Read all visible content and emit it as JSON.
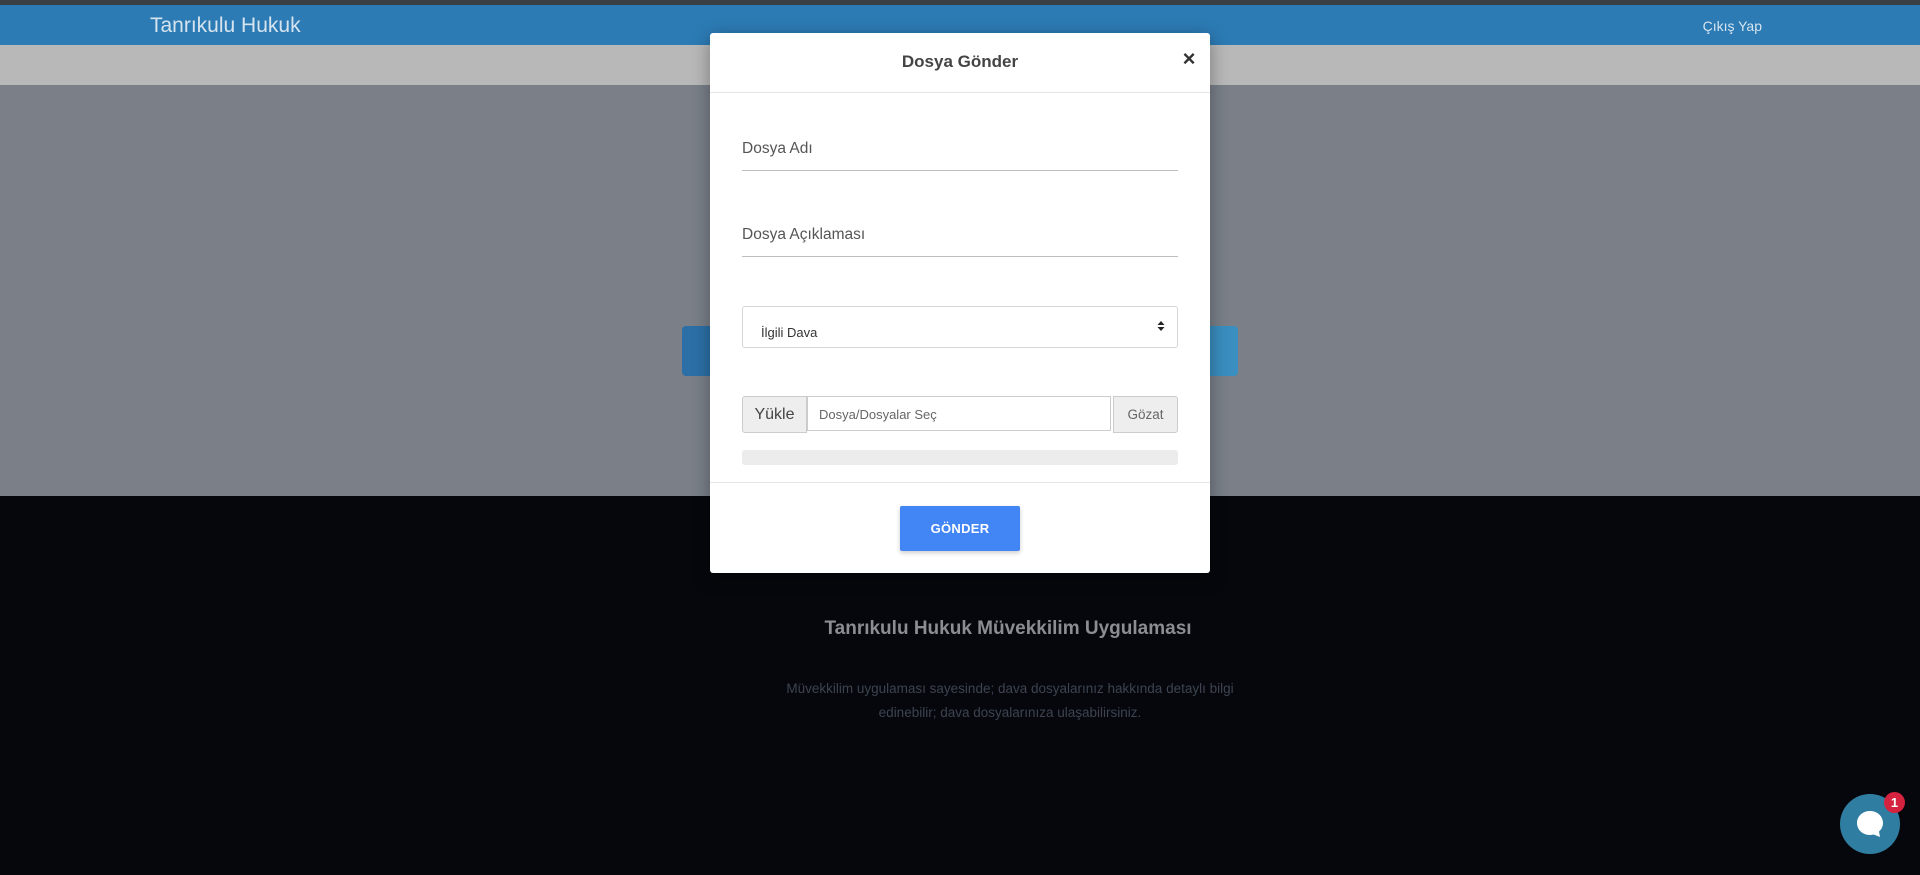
{
  "navbar": {
    "brand": "Tanrıkulu Hukuk",
    "logout_label": "Çıkış Yap",
    "color": "#2c7bb4"
  },
  "footer": {
    "title": "Tanrıkulu Hukuk Müvekkilim Uygulaması",
    "description": "Müvekkilim uygulaması sayesinde; dava dosyalarınız hakkında detaylı bilgi edinebilir; dava dosyalarınıza ulaşabilirsiniz."
  },
  "modal": {
    "title": "Dosya Gönder",
    "close_label": "×",
    "file_name_label": "Dosya Adı",
    "file_description_label": "Dosya Açıklaması",
    "case_select": {
      "selected": "İlgili Dava"
    },
    "upload": {
      "addon_label": "Yükle",
      "input_placeholder": "Dosya/Dosyalar Seç",
      "browse_label": "Gözat"
    },
    "progress": 0,
    "submit_label": "GÖNDER",
    "accent_color": "#4285f4"
  },
  "chat_widget": {
    "icon": "chat-bubble-icon",
    "badge_count": "1",
    "color": "#2f7ea2",
    "badge_color": "#d5223f"
  }
}
